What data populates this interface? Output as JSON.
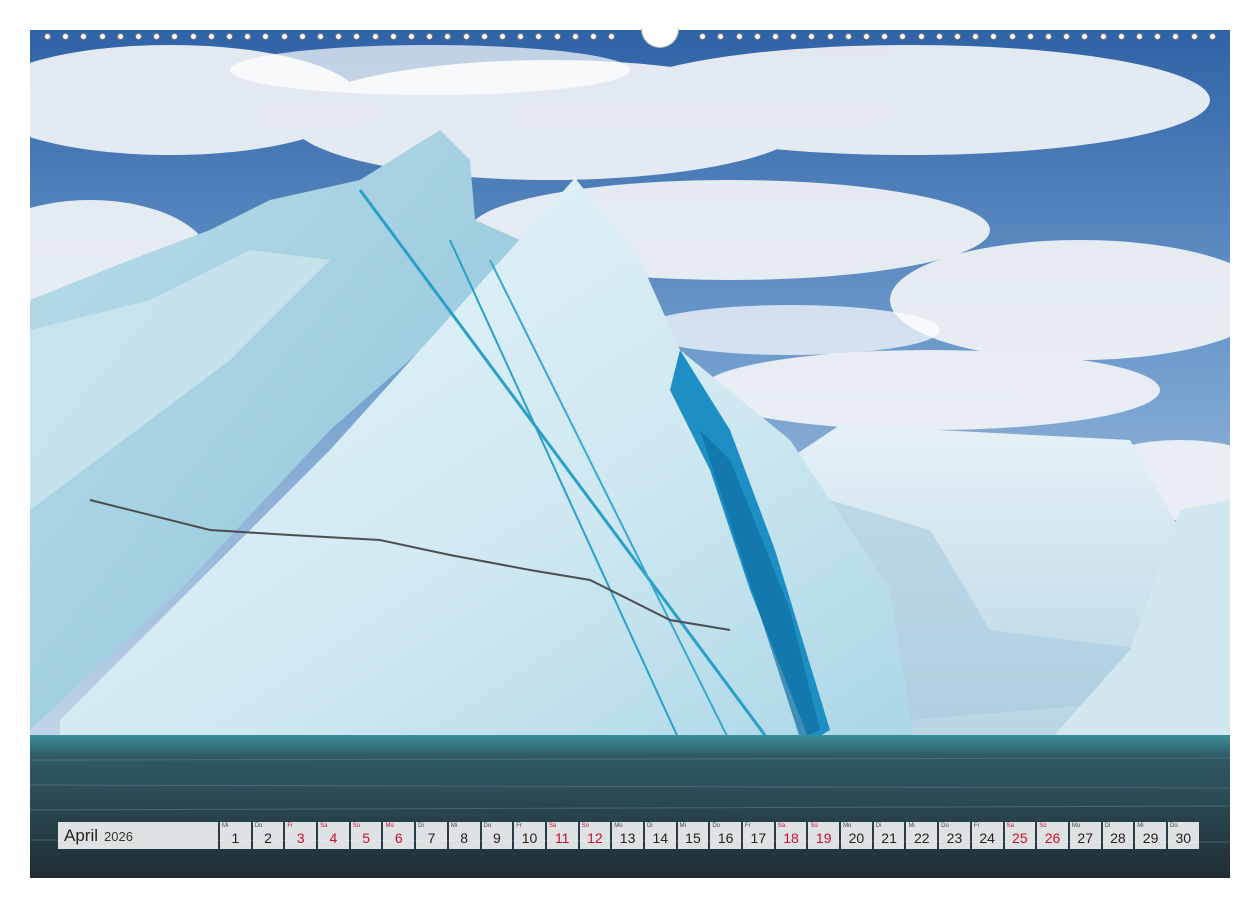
{
  "calendar": {
    "month": "April",
    "year": "2026",
    "days": [
      {
        "wd": "Mi",
        "num": "1",
        "weekend": false
      },
      {
        "wd": "Do",
        "num": "2",
        "weekend": false
      },
      {
        "wd": "Fr",
        "num": "3",
        "weekend": true
      },
      {
        "wd": "Sa",
        "num": "4",
        "weekend": true
      },
      {
        "wd": "So",
        "num": "5",
        "weekend": true
      },
      {
        "wd": "Mo",
        "num": "6",
        "weekend": true
      },
      {
        "wd": "Di",
        "num": "7",
        "weekend": false
      },
      {
        "wd": "Mi",
        "num": "8",
        "weekend": false
      },
      {
        "wd": "Do",
        "num": "9",
        "weekend": false
      },
      {
        "wd": "Fr",
        "num": "10",
        "weekend": false
      },
      {
        "wd": "Sa",
        "num": "11",
        "weekend": true
      },
      {
        "wd": "So",
        "num": "12",
        "weekend": true
      },
      {
        "wd": "Mo",
        "num": "13",
        "weekend": false
      },
      {
        "wd": "Di",
        "num": "14",
        "weekend": false
      },
      {
        "wd": "Mi",
        "num": "15",
        "weekend": false
      },
      {
        "wd": "Do",
        "num": "16",
        "weekend": false
      },
      {
        "wd": "Fr",
        "num": "17",
        "weekend": false
      },
      {
        "wd": "Sa",
        "num": "18",
        "weekend": true
      },
      {
        "wd": "So",
        "num": "19",
        "weekend": true
      },
      {
        "wd": "Mo",
        "num": "20",
        "weekend": false
      },
      {
        "wd": "Di",
        "num": "21",
        "weekend": false
      },
      {
        "wd": "Mi",
        "num": "22",
        "weekend": false
      },
      {
        "wd": "Do",
        "num": "23",
        "weekend": false
      },
      {
        "wd": "Fr",
        "num": "24",
        "weekend": false
      },
      {
        "wd": "Sa",
        "num": "25",
        "weekend": true
      },
      {
        "wd": "So",
        "num": "26",
        "weekend": true
      },
      {
        "wd": "Mo",
        "num": "27",
        "weekend": false
      },
      {
        "wd": "Di",
        "num": "28",
        "weekend": false
      },
      {
        "wd": "Mi",
        "num": "29",
        "weekend": false
      },
      {
        "wd": "Do",
        "num": "30",
        "weekend": false
      }
    ]
  },
  "colors": {
    "weekend": "#c8102e",
    "sky": "#3d6fb0",
    "ice": "#d7ecf3",
    "ice_blue": "#1e8fc0",
    "sea": "#2f4650"
  }
}
